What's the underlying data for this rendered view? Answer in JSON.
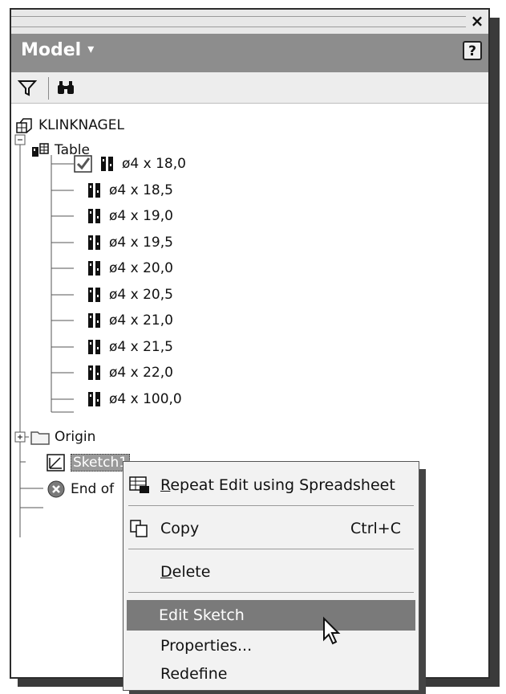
{
  "window": {
    "close_glyph": "×"
  },
  "header": {
    "title": "Model",
    "caret": "▾",
    "help": "?"
  },
  "toolbar": {
    "filter_icon": "filter-icon",
    "find_icon": "binoculars-icon"
  },
  "tree": {
    "root": "KLINKNAGEL",
    "table": "Table",
    "rows": [
      "ø4 x 18,0",
      "ø4 x 18,5",
      "ø4 x 19,0",
      "ø4 x 19,5",
      "ø4 x 20,0",
      "ø4 x 20,5",
      "ø4 x 21,0",
      "ø4 x 21,5",
      "ø4 x 22,0",
      "ø4 x 100,0"
    ],
    "origin": "Origin",
    "sketch": "Sketch1",
    "end": "End of"
  },
  "context_menu": {
    "repeat_pre": "",
    "repeat_u": "R",
    "repeat_post": "epeat Edit using Spreadsheet",
    "copy": "Copy",
    "copy_shortcut": "Ctrl+C",
    "delete_u": "D",
    "delete_post": "elete",
    "edit_sketch": "Edit Sketch",
    "properties": "Properties...",
    "redefine": "Redefine"
  },
  "colors": {
    "header": "#8d8d8d",
    "highlight": "#7a7a7a",
    "menu_bg": "#f2f2f2"
  }
}
